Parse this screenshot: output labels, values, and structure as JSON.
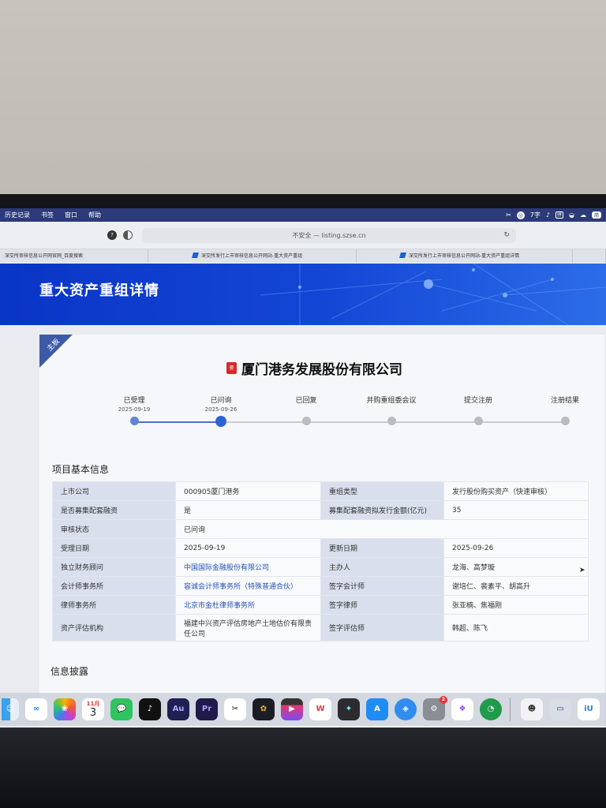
{
  "menubar": {
    "items": [
      "历史记录",
      "书签",
      "窗口",
      "帮助"
    ],
    "status": {
      "input": "7字",
      "lang": "拼",
      "badge": "简"
    }
  },
  "browser": {
    "url": "不安全 — listing.szse.cn",
    "tabs": [
      "深交所审核信息公开网官网_百度搜索",
      "深交所发行上市审核信息公开网站-重大资产重组",
      "深交所发行上市审核信息公开网站-重大资产重组详情"
    ]
  },
  "banner": {
    "title": "重大资产重组详情"
  },
  "card": {
    "ribbon": "主板",
    "company_name": "厦门港务发展股份有限公司",
    "logo_text": "瓷"
  },
  "progress": {
    "steps": [
      {
        "label": "已受理",
        "date": "2025-09-19",
        "state": "done"
      },
      {
        "label": "已问询",
        "date": "2025-09-26",
        "state": "current"
      },
      {
        "label": "已回复",
        "date": "",
        "state": "pending"
      },
      {
        "label": "并购重组委会议",
        "date": "",
        "state": "pending"
      },
      {
        "label": "提交注册",
        "date": "",
        "state": "pending"
      },
      {
        "label": "注册结果",
        "date": "",
        "state": "pending"
      }
    ]
  },
  "basic_info": {
    "title": "项目基本信息",
    "listed_company_label": "上市公司",
    "listed_company": "000905厦门港务",
    "reorg_type_label": "重组类型",
    "reorg_type": "发行股份购买资产（快速审核）",
    "supporting_funds_label": "是否募集配套融资",
    "supporting_funds": "是",
    "raise_amount_label": "募集配套融资拟发行金额(亿元)",
    "raise_amount": "35",
    "review_status_label": "审核状态",
    "review_status": "已问询",
    "accept_date_label": "受理日期",
    "accept_date": "2025-09-19",
    "update_date_label": "更新日期",
    "update_date": "2025-09-26",
    "advisor_label": "独立财务顾问",
    "advisor": "中国国际金融股份有限公司",
    "sponsor_label": "主办人",
    "sponsor": "龙海、高梦璇",
    "accounting_firm_label": "会计师事务所",
    "accounting_firm": "容诚会计师事务所（特殊普通合伙）",
    "accountant_label": "签字会计师",
    "accountant": "谢培仁、裴素平、胡高升",
    "law_firm_label": "律师事务所",
    "law_firm": "北京市金杜律师事务所",
    "lawyer_label": "签字律师",
    "lawyer": "张亚楠、焦福刚",
    "appraiser_org_label": "资产评估机构",
    "appraiser_org": "福建中兴资产评估房地产土地估价有限责任公司",
    "appraiser_label": "签字评估师",
    "appraiser": "韩超、陈飞"
  },
  "disclosure": {
    "title": "信息披露"
  },
  "dock": {
    "calendar_month": "11月",
    "calendar_day": "3",
    "settings_badge": "2",
    "apps": [
      "finder-icon",
      "baidu-netdisk-icon",
      "photos-icon",
      "calendar-icon",
      "wechat-icon",
      "tiktok-icon",
      "audition-icon",
      "premiere-icon",
      "capcut-icon",
      "davinci-icon",
      "final-cut-icon",
      "wps-icon",
      "dictionary-icon",
      "app-store-icon",
      "safari-icon",
      "system-settings-icon",
      "shortcuts-icon",
      "green-app-icon",
      "avatar-icon",
      "preview-icon",
      "iu-icon"
    ]
  }
}
